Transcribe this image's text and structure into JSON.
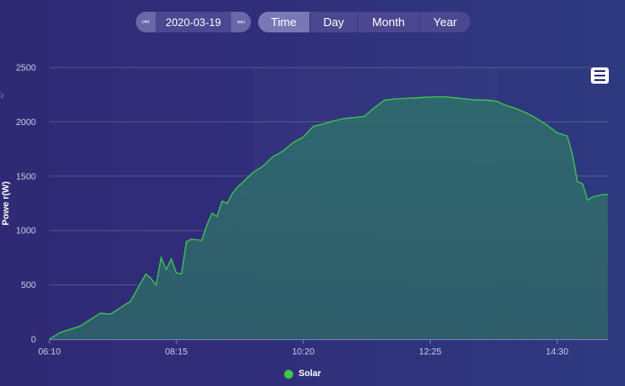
{
  "toolbar": {
    "date": "2020-03-19",
    "prev_icon": "skip-previous-icon",
    "next_icon": "skip-next-icon",
    "tabs": [
      {
        "label": "Time",
        "active": true
      },
      {
        "label": "Day",
        "active": false
      },
      {
        "label": "Month",
        "active": false
      },
      {
        "label": "Year",
        "active": false
      }
    ]
  },
  "menu_icon": "hamburger-menu-icon",
  "chart_data": {
    "type": "area",
    "ylabel": "Powe r(W)",
    "ylim": [
      0,
      2500
    ],
    "yticks": [
      0,
      500,
      1000,
      1500,
      2000,
      2500
    ],
    "xlim": [
      "06:10",
      "15:20"
    ],
    "xticks": [
      "06:10",
      "08:15",
      "10:20",
      "12:25",
      "14:30"
    ],
    "grid": true,
    "legend": "bottom-center",
    "series": [
      {
        "name": "Solar",
        "color": "#3cc84a",
        "x": [
          "06:10",
          "06:20",
          "06:30",
          "06:40",
          "06:50",
          "07:00",
          "07:10",
          "07:20",
          "07:30",
          "07:40",
          "07:45",
          "07:50",
          "07:55",
          "08:00",
          "08:05",
          "08:10",
          "08:15",
          "08:20",
          "08:25",
          "08:30",
          "08:40",
          "08:45",
          "08:50",
          "08:55",
          "09:00",
          "09:05",
          "09:10",
          "09:15",
          "09:20",
          "09:30",
          "09:40",
          "09:50",
          "10:00",
          "10:10",
          "10:20",
          "10:30",
          "10:40",
          "10:50",
          "11:00",
          "11:10",
          "11:20",
          "11:30",
          "11:40",
          "11:50",
          "12:00",
          "12:10",
          "12:20",
          "12:30",
          "12:40",
          "12:50",
          "13:00",
          "13:10",
          "13:20",
          "13:30",
          "13:40",
          "13:50",
          "14:00",
          "14:10",
          "14:20",
          "14:30",
          "14:40",
          "14:45",
          "14:50",
          "14:55",
          "15:00",
          "15:05",
          "15:10",
          "15:15",
          "15:20"
        ],
        "values": [
          0,
          60,
          90,
          120,
          180,
          240,
          230,
          290,
          350,
          520,
          600,
          560,
          500,
          750,
          640,
          740,
          610,
          600,
          900,
          920,
          910,
          1050,
          1160,
          1130,
          1270,
          1250,
          1340,
          1400,
          1440,
          1530,
          1590,
          1680,
          1730,
          1810,
          1860,
          1960,
          1980,
          2010,
          2030,
          2040,
          2050,
          2130,
          2200,
          2210,
          2215,
          2220,
          2225,
          2230,
          2230,
          2220,
          2210,
          2200,
          2200,
          2190,
          2150,
          2120,
          2080,
          2030,
          1970,
          1900,
          1870,
          1700,
          1450,
          1430,
          1280,
          1310,
          1320,
          1330,
          1330
        ]
      }
    ]
  }
}
